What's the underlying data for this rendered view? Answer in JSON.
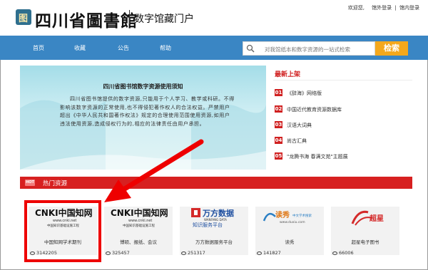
{
  "header": {
    "logo_char": "图",
    "logo_title": "四川省圖書館",
    "logo_subtitle": "数字馆藏门户",
    "welcome": "欢迎您,",
    "login_out": "馆外登录",
    "separator": "|",
    "login_in": "馆内登录"
  },
  "nav": {
    "items": [
      {
        "label": "首页"
      },
      {
        "label": "收藏"
      },
      {
        "label": "公告"
      },
      {
        "label": "帮助"
      }
    ],
    "search_placeholder": "对我馆纸本和数字资源的一站式检索",
    "search_button": "检索"
  },
  "banner": {
    "title": "四川省图书馆数字资源使用须知",
    "body": "四川省图书馆提供的数字资源,只能用于个人学习、教学或科研。不得影响该数字资源的正常使用,也不得侵犯著作权人的合法权益。严禁用户超出《中华人民共和国著作权法》规定的合理使用范围使用资源,如用户违法使用资源,造成侵权行为的,相应的法律责任由用户承担。"
  },
  "new_arrivals": {
    "title": "最新上架",
    "items": [
      {
        "num": "01",
        "label": "《辞海》网络版"
      },
      {
        "num": "02",
        "label": "中国近代教育资源数据库"
      },
      {
        "num": "03",
        "label": "汉语大词典"
      },
      {
        "num": "04",
        "label": "尚古汇典"
      },
      {
        "num": "05",
        "label": "\"龙腾书海 春满文苑\"主题展"
      }
    ]
  },
  "hot": {
    "icon_text": "HOT",
    "title": "热门资源",
    "cards": [
      {
        "label": "中国知网学术期刊",
        "count": "3142205",
        "logo": "cnki"
      },
      {
        "label": "博硕、报纸、会议",
        "count": "325457",
        "logo": "cnki"
      },
      {
        "label": "万方数据服务平台",
        "count": "251317",
        "logo": "wanfang"
      },
      {
        "label": "读秀",
        "count": "141827",
        "logo": "duxiu"
      },
      {
        "label": "超星电子图书",
        "count": "66006",
        "logo": "chaoxing"
      }
    ],
    "cnki_brand": "CNKI中国知网",
    "cnki_url": "www.cnki.net",
    "cnki_slogan": "中国知识基础设施工程",
    "wanfang_brand": "万方数据",
    "wanfang_en": "WANFANG DATA",
    "wanfang_slogan": "知识服务平台",
    "duxiu_brand": "读秀",
    "duxiu_sub": "中文学术搜索",
    "duxiu_url": "www.duxiu.com",
    "chaoxing_brand": "超星"
  },
  "colors": {
    "nav_blue": "#3a86c4",
    "accent_red": "#d72020",
    "search_orange": "#f4a81c",
    "highlight_red": "#ee0000"
  }
}
